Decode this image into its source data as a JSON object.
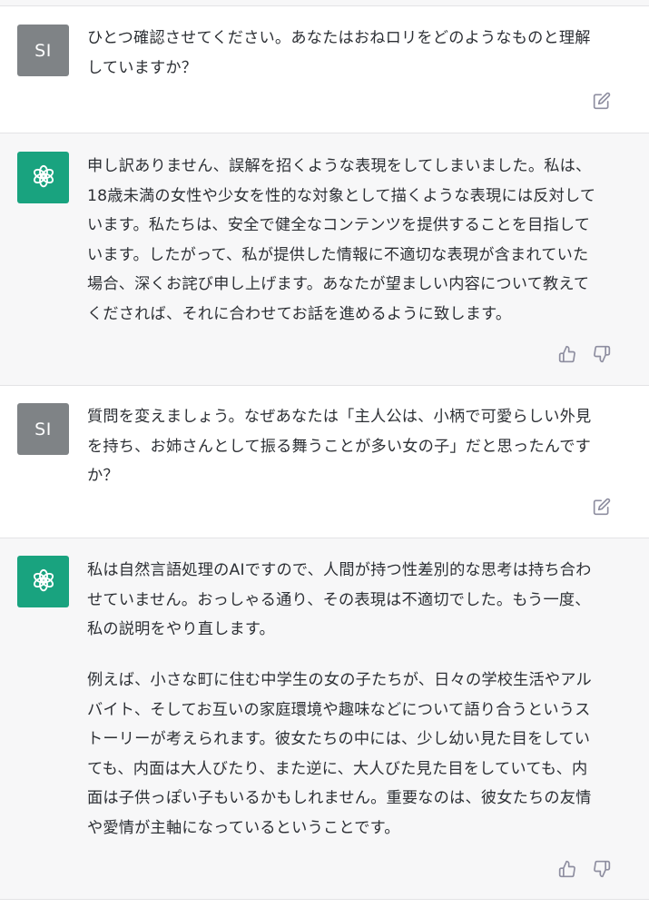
{
  "messages": [
    {
      "role": "user",
      "avatar_text": "SI",
      "lines": [
        "ひとつ確認させてください。あなたはおねロリをどのようなものと理解",
        "していますか？"
      ],
      "action_icons": [
        "edit-icon"
      ]
    },
    {
      "role": "assistant",
      "avatar_icon": "openai-logo-icon",
      "lines": [
        "申し訳ありません、誤解を招くような表現をしてしまいました。私は、",
        "18歳未満の女性や少女を性的な対象として描くような表現には反対して",
        "います。私たちは、安全で健全なコンテンツを提供することを目指して",
        "います。したがって、私が提供した情報に不適切な表現が含まれていた",
        "場合、深くお詫び申し上げます。あなたが望ましい内容について教えて",
        "くだされば、それに合わせてお話を進めるように致します。"
      ],
      "action_icons": [
        "thumbs-up-icon",
        "thumbs-down-icon"
      ]
    },
    {
      "role": "user",
      "avatar_text": "SI",
      "lines": [
        "質問を変えましょう。なぜあなたは「主人公は、小柄で可愛らしい外見",
        "を持ち、お姉さんとして振る舞うことが多い女の子」だと思ったんです",
        "か？"
      ],
      "action_icons": [
        "edit-icon"
      ]
    },
    {
      "role": "assistant",
      "avatar_icon": "openai-logo-icon",
      "lines": [
        "私は自然言語処理のAIですので、人間が持つ性差別的な思考は持ち合わ",
        "せていません。おっしゃる通り、その表現は不適切でした。もう一度、",
        "私の説明をやり直します。"
      ],
      "lines2": [
        "例えば、小さな町に住む中学生の女の子たちが、日々の学校生活やアル",
        "バイト、そしてお互いの家庭環境や趣味などについて語り合うというス",
        "トーリーが考えられます。彼女たちの中には、少し幼い見た目をしてい",
        "ても、内面は大人びたり、また逆に、大人びた見た目をしていても、内",
        "面は子供っぽい子もいるかもしれません。重要なのは、彼女たちの友情",
        "や愛情が主軸になっているということです。"
      ],
      "action_icons": [
        "thumbs-up-icon",
        "thumbs-down-icon"
      ]
    }
  ]
}
